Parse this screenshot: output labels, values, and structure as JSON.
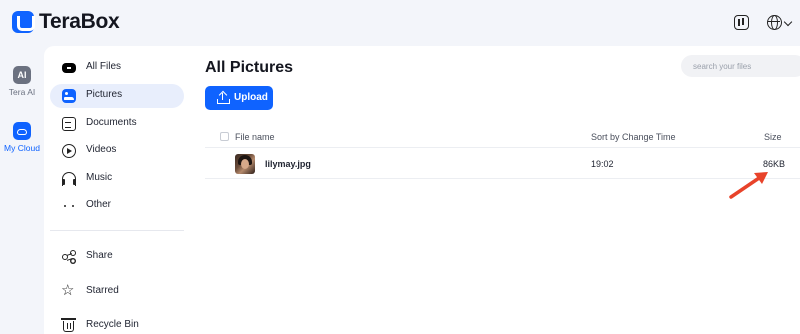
{
  "app": {
    "name": "TeraBox"
  },
  "topbar": {
    "transfer_icon": "transfer-icon",
    "language_icon": "globe-icon"
  },
  "rail": {
    "items": [
      {
        "label": "Tera AI",
        "icon_text": "AI",
        "icon": "ai-icon"
      },
      {
        "label": "My Cloud",
        "icon": "cloud-icon",
        "active": true
      }
    ]
  },
  "sidebar": {
    "items": [
      {
        "label": "All Files",
        "icon": "all-files-icon"
      },
      {
        "label": "Pictures",
        "icon": "pictures-icon",
        "active": true
      },
      {
        "label": "Documents",
        "icon": "documents-icon"
      },
      {
        "label": "Videos",
        "icon": "videos-icon"
      },
      {
        "label": "Music",
        "icon": "music-icon"
      },
      {
        "label": "Other",
        "icon": "more-icon"
      }
    ],
    "secondary": [
      {
        "label": "Share",
        "icon": "share-icon"
      },
      {
        "label": "Starred",
        "icon": "star-icon"
      },
      {
        "label": "Recycle Bin",
        "icon": "trash-icon"
      }
    ]
  },
  "main": {
    "title": "All Pictures",
    "search_placeholder": "search your files",
    "upload_label": "Upload",
    "columns": {
      "name": "File name",
      "time": "Sort by Change Time",
      "size": "Size"
    },
    "rows": [
      {
        "name": "lilymay.jpg",
        "time": "19:02",
        "size": "86KB"
      }
    ]
  },
  "colors": {
    "accent": "#0f63ff",
    "annotation_arrow": "#e8432a",
    "active_bg": "#e8eefc"
  }
}
